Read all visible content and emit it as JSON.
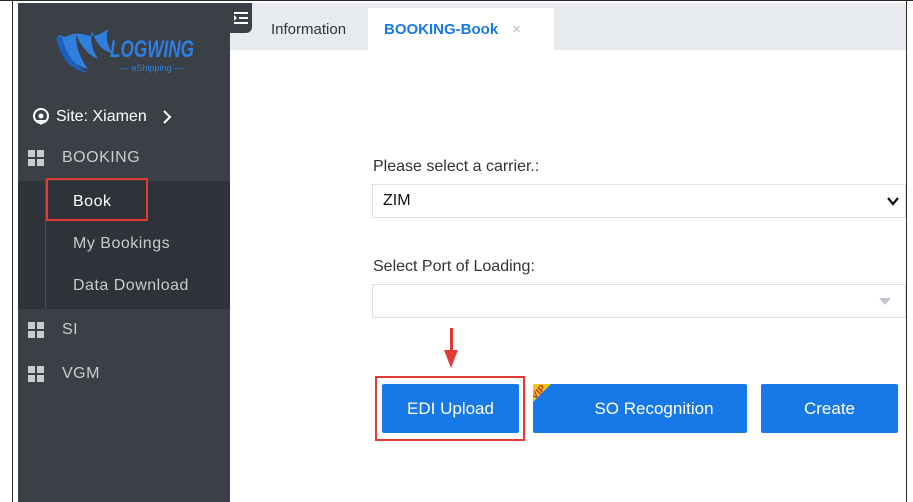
{
  "sidebar": {
    "logo": {
      "brand": "LOGWING",
      "tagline": "— eShipping —",
      "icon": "wing-logo-icon"
    },
    "site": {
      "label": "Site:",
      "value": "Xiamen",
      "icon": "location-pin-icon"
    },
    "menu": [
      {
        "label": "BOOKING",
        "icon": "grid-icon"
      },
      {
        "label": "SI",
        "icon": "grid-icon"
      },
      {
        "label": "VGM",
        "icon": "grid-icon"
      }
    ],
    "booking_sub": [
      {
        "label": "Book",
        "active": true
      },
      {
        "label": "My Bookings",
        "active": false
      },
      {
        "label": "Data Download",
        "active": false
      }
    ]
  },
  "tabs": [
    {
      "label": "Information"
    },
    {
      "label": "BOOKING-Book",
      "active": true,
      "close": "×"
    }
  ],
  "form": {
    "carrier_label": "Please select a carrier.:",
    "carrier_value": "ZIM",
    "port_label": "Select Port of Loading:",
    "port_value": ""
  },
  "buttons": {
    "edi": "EDI Upload",
    "so": "SO Recognition",
    "so_badge": "VIP",
    "create": "Create"
  },
  "colors": {
    "sidebar_bg": "#3b3f46",
    "submenu_bg": "#2f3238",
    "accent": "#1778e8",
    "highlight": "#e53935",
    "vip_badge": "#f5c518"
  }
}
